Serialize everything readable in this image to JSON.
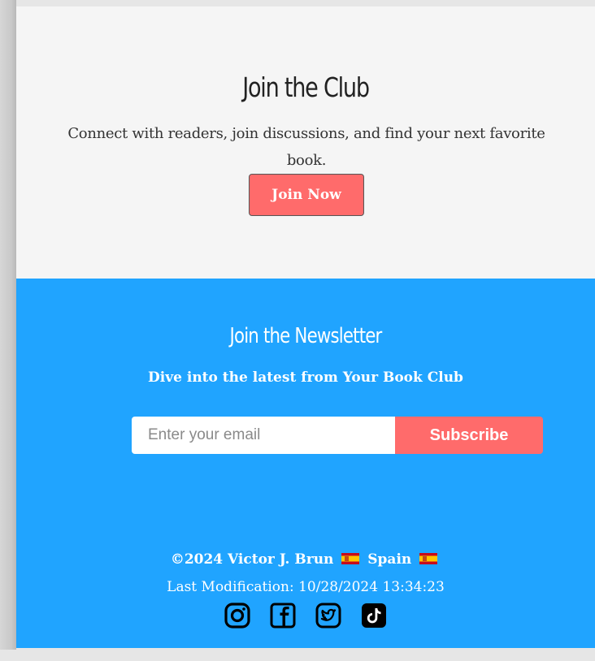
{
  "club": {
    "title": "Join the Club",
    "description": "Connect with readers, join discussions, and find your next favorite book.",
    "join_button": "Join Now"
  },
  "newsletter": {
    "title": "Join the Newsletter",
    "tagline": "Dive into the latest from Your Book Club",
    "email_placeholder": "Enter your email",
    "subscribe_button": "Subscribe"
  },
  "footer": {
    "copyright": "©2024 Victor J. Brun",
    "country": "Spain",
    "last_modification": "Last Modification: 10/28/2024 13:34:23",
    "socials": [
      "instagram-icon",
      "facebook-icon",
      "twitter-icon",
      "tiktok-icon"
    ]
  },
  "colors": {
    "club_background": "#f5f5f5",
    "newsletter_background": "#20a4ff",
    "button_accent": "#ff6b6b"
  }
}
